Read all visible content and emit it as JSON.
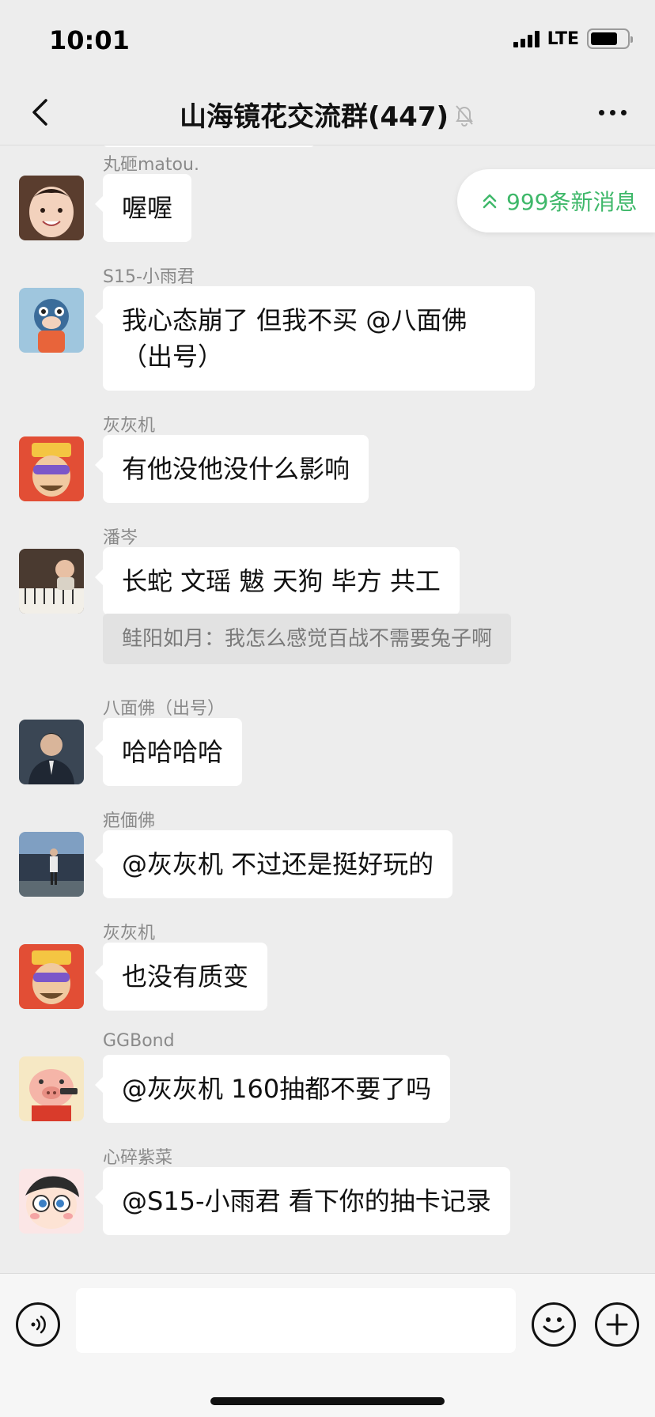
{
  "status": {
    "time": "10:01",
    "network": "LTE",
    "battery_level": 0.75
  },
  "nav": {
    "title": "山海镜花交流群(447)"
  },
  "new_messages": {
    "label": "999条新消息"
  },
  "messages": [
    {
      "sender": "丸砸matou.",
      "text": "喔喔"
    },
    {
      "sender": "S15-小雨君",
      "text": "我心态崩了 但我不买 @八面佛（出号）"
    },
    {
      "sender": "灰灰机",
      "text": "有他没他没什么影响"
    },
    {
      "sender": "潘岑",
      "text": "长蛇 文瑶 魃 天狗 毕方 共工",
      "quote": "鲑阳如月：我怎么感觉百战不需要兔子啊"
    },
    {
      "sender": "八面佛（出号）",
      "text": "哈哈哈哈"
    },
    {
      "sender": "疤偭佛",
      "text": "@灰灰机 不过还是挺好玩的"
    },
    {
      "sender": "灰灰机",
      "text": "也没有质变"
    },
    {
      "sender": "GGBond",
      "text": "@灰灰机 160抽都不要了吗"
    },
    {
      "sender": "心碎紫菜",
      "text": "@S15-小雨君 看下你的抽卡记录"
    }
  ],
  "input": {
    "placeholder": ""
  },
  "colors": {
    "accent_green": "#3fb86a",
    "bubble": "#ffffff",
    "background": "#ededed"
  }
}
